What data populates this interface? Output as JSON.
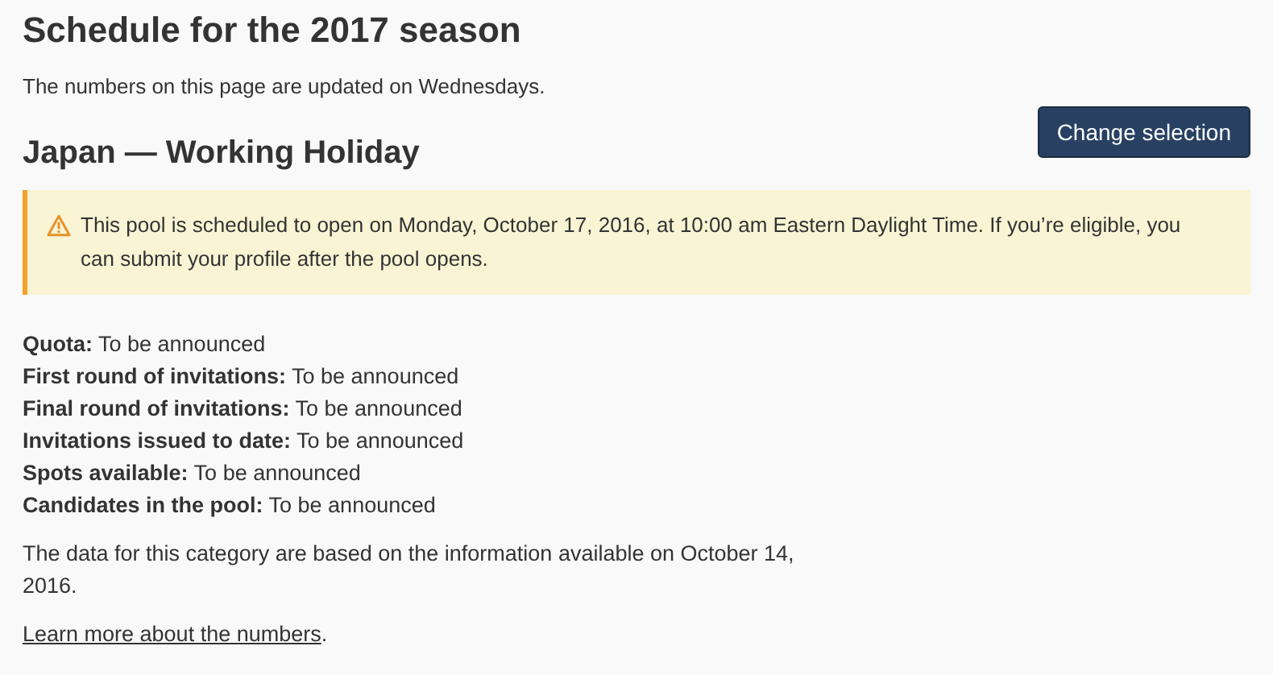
{
  "title": "Schedule for the 2017 season",
  "intro": "The numbers on this page are updated on Wednesdays.",
  "category": {
    "heading": "Japan — Working Holiday",
    "button": "Change selection"
  },
  "alert": {
    "kind": "warning",
    "text": "This pool is scheduled to open on Monday, October 17, 2016, at 10:00 am Eastern Daylight Time. If you’re eligible, you can submit your profile after the pool opens."
  },
  "stats": [
    {
      "text": "**Quota:** To be announced"
    },
    {
      "text": "**First round of invitations:** To be announced"
    },
    {
      "text": "**Final round of invitations:** To be announced"
    },
    {
      "text": "**Invitations issued to date:** To be announced"
    },
    {
      "text": "**Spots available:** To be announced"
    },
    {
      "text": "**Candidates in the pool:** To be announced"
    }
  ],
  "note": "The data for this category are based on the information available on October 14, 2016.",
  "footer": {
    "link": "Learn more about the numbers",
    "after": "."
  }
}
